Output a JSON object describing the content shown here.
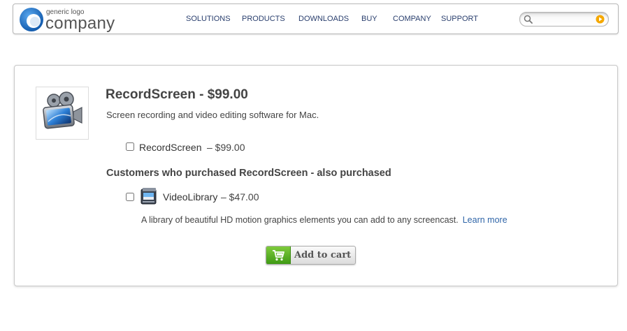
{
  "header": {
    "logo_small": "generic logo",
    "logo_big": "company",
    "nav": [
      {
        "label": "SOLUTIONS"
      },
      {
        "label": "PRODUCTS"
      },
      {
        "label": "DOWNLOADS"
      },
      {
        "label": "BUY"
      },
      {
        "label": "COMPANY"
      },
      {
        "label": "SUPPORT"
      }
    ],
    "search": {
      "value": "",
      "placeholder": ""
    },
    "icons": {
      "search": "magnifier-icon",
      "go": "orange-arrow-go-icon"
    },
    "colors": {
      "nav_text": "#2a3f6e",
      "logo_blue": "#1e6fc4",
      "go_orange": "#f5a800"
    }
  },
  "product": {
    "title": "RecordScreen - $99.00",
    "description": "Screen recording and video editing software for Mac.",
    "thumb_icon": "film-camera-icon",
    "option": {
      "name": "RecordScreen",
      "price": "– $99.00",
      "checked": false
    }
  },
  "upsell": {
    "heading": "Customers who purchased RecordScreen - also purchased",
    "item": {
      "name": "VideoLibrary",
      "price": "– $47.00",
      "checked": false,
      "icon": "video-library-icon",
      "description": "A library of beautiful HD motion graphics elements you can add to any screencast.",
      "learn_more": "Learn more"
    }
  },
  "cart": {
    "label": "Add to cart",
    "icon": "shopping-cart-icon",
    "accent": "#4fa81e"
  }
}
